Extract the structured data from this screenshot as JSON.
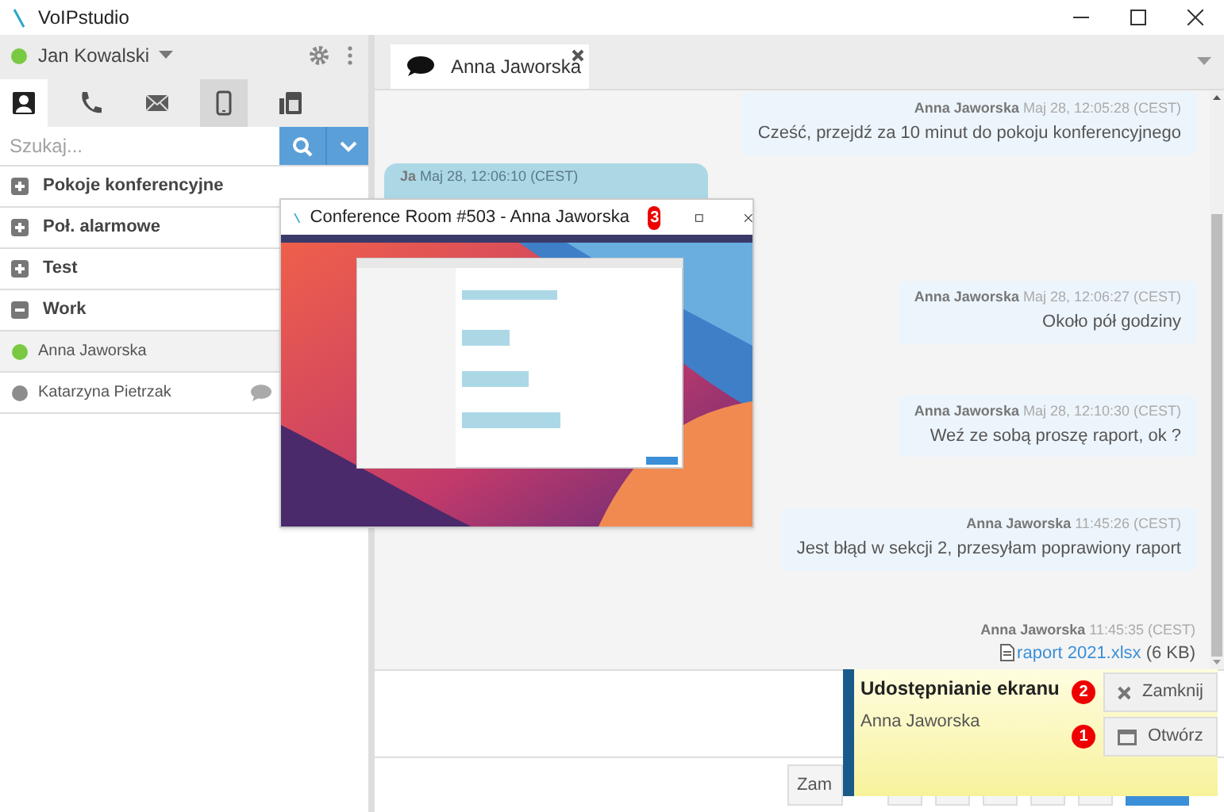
{
  "app": {
    "title": "VoIPstudio"
  },
  "user": {
    "name": "Jan Kowalski",
    "color": "#7ac943"
  },
  "nav_tabs": [
    {
      "kind": "contacts",
      "selected": true,
      "highlighted": false
    },
    {
      "kind": "phone",
      "selected": false,
      "highlighted": false
    },
    {
      "kind": "mail",
      "selected": false,
      "highlighted": false
    },
    {
      "kind": "mobile",
      "selected": false,
      "highlighted": true
    },
    {
      "kind": "fax",
      "selected": false,
      "highlighted": false
    }
  ],
  "search": {
    "placeholder": "Szukaj..."
  },
  "groups": [
    {
      "label": "Pokoje konferencyjne",
      "expanded": false
    },
    {
      "label": "Poł. alarmowe",
      "expanded": false
    },
    {
      "label": "Test",
      "expanded": false
    },
    {
      "label": "Work",
      "expanded": true,
      "children": [
        {
          "name": "Anna Jaworska",
          "color": "#7ac943",
          "selected": true,
          "has_message": false
        },
        {
          "name": "Katarzyna Pietrzak",
          "color": "#8c8c8c",
          "selected": false,
          "has_message": true
        }
      ]
    }
  ],
  "chat_tabs": [
    {
      "label": "Anna Jaworska",
      "selected": true
    }
  ],
  "messages": [
    {
      "kind": "incoming",
      "sender": "Anna Jaworska",
      "time": "Maj 28, 12:05:28 (CEST)",
      "text": "Cześć, przejdź za 10 minut do pokoju konferencyjnego"
    },
    {
      "kind": "outgoing",
      "sender": "Ja",
      "time": "Maj 28, 12:06:10 (CEST)"
    },
    {
      "kind": "incoming",
      "sender": "Anna Jaworska",
      "time": "Maj 28, 12:06:27 (CEST)",
      "text": "Około pół godziny"
    },
    {
      "kind": "incoming",
      "sender": "Anna Jaworska",
      "time": "Maj 28, 12:10:30 (CEST)",
      "text": "Weź ze sobą proszę raport, ok ?"
    },
    {
      "kind": "incoming",
      "sender": "Anna Jaworska",
      "time": "11:45:26 (CEST)",
      "text": "Jest błąd w sekcji 2, przesyłam poprawiony raport"
    },
    {
      "kind": "file",
      "sender": "Anna Jaworska",
      "time": "11:45:35 (CEST)",
      "file": "raport 2021.xlsx",
      "size": "(6 KB)"
    }
  ],
  "toolbar": {
    "button": "Zam"
  },
  "conference_window": {
    "title": "Conference Room #503 - Anna Jaworska",
    "badge": "3"
  },
  "notification": {
    "title": "Udostępnianie ekranu",
    "caller": "Anna Jaworska",
    "buttons": [
      {
        "kind": "close",
        "label": "Zamknij",
        "badge": "2"
      },
      {
        "kind": "open",
        "label": "Otwórz",
        "badge": "1"
      }
    ]
  }
}
